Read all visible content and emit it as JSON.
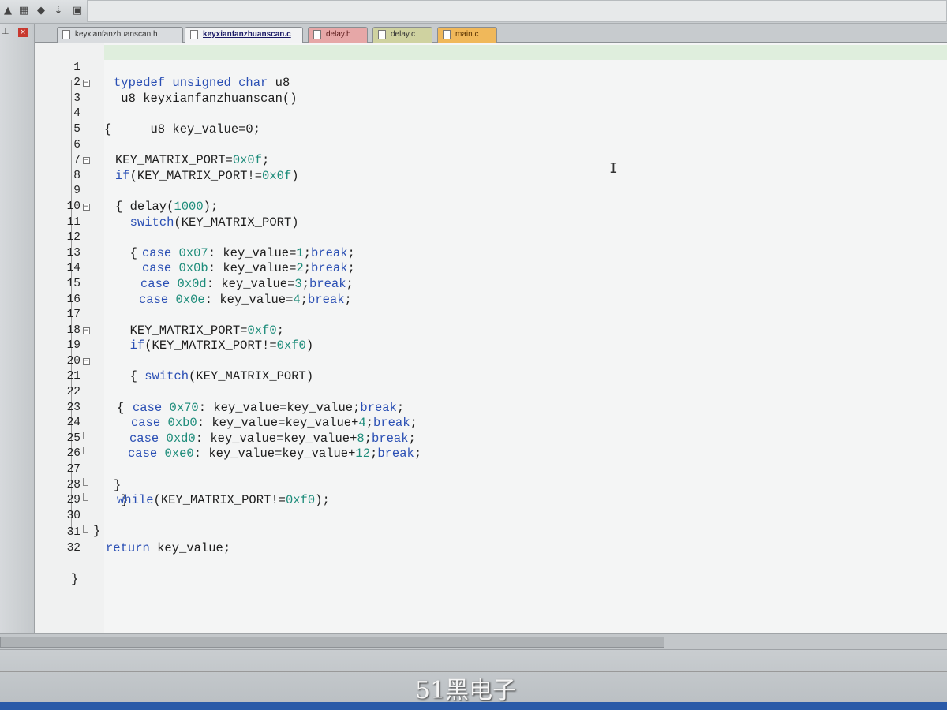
{
  "toolbar": {
    "icons": [
      "build-icon",
      "target-options-icon",
      "debug-icon",
      "download-icon",
      "batch-icon"
    ]
  },
  "left_pane": {
    "pin_icon": "pin-icon",
    "close_icon": "close-icon",
    "pin_glyph": "⊥",
    "close_glyph": "×"
  },
  "tabs": [
    {
      "label": "keyxianfanzhuanscan.h"
    },
    {
      "label": "keyxianfanzhuanscan.c"
    },
    {
      "label": "delay.h"
    },
    {
      "label": "delay.c"
    },
    {
      "label": "main.c"
    }
  ],
  "editor": {
    "lines": [
      {
        "n": "1"
      },
      {
        "n": "2"
      },
      {
        "n": "3"
      },
      {
        "n": "4"
      },
      {
        "n": "5"
      },
      {
        "n": "6"
      },
      {
        "n": "7"
      },
      {
        "n": "8"
      },
      {
        "n": "9"
      },
      {
        "n": "10"
      },
      {
        "n": "11"
      },
      {
        "n": "12"
      },
      {
        "n": "13"
      },
      {
        "n": "14"
      },
      {
        "n": "15"
      },
      {
        "n": "16"
      },
      {
        "n": "17"
      },
      {
        "n": "18"
      },
      {
        "n": "19"
      },
      {
        "n": "20"
      },
      {
        "n": "21"
      },
      {
        "n": "22"
      },
      {
        "n": "23"
      },
      {
        "n": "24"
      },
      {
        "n": "25"
      },
      {
        "n": "26"
      },
      {
        "n": "27"
      },
      {
        "n": "28"
      },
      {
        "n": "29"
      },
      {
        "n": "30"
      },
      {
        "n": "31"
      },
      {
        "n": "32"
      }
    ],
    "code": {
      "l1": [
        "typedef unsigned char",
        " u8"
      ],
      "l2": " u8 keyxianfanzhuanscan()",
      "l3": "{",
      "l4": "     u8 key_value=0;",
      "l6a": "KEY_MATRIX_PORT=",
      "l6b": "0x0f",
      "l6c": ";",
      "l7a": "if",
      "l7b": "(KEY_MATRIX_PORT!=",
      "l7c": "0x0f",
      "l7d": ")",
      "l8": "{",
      "l9a": "  delay(",
      "l9b": "1000",
      "l9c": ");",
      "l10a": "  switch",
      "l10b": "(KEY_MATRIX_PORT)",
      "l11": "  {",
      "l12": [
        "case",
        "0x07",
        ": key_value=",
        "1",
        ";",
        "break",
        ";"
      ],
      "l13": [
        "case",
        "0x0b",
        ": key_value=",
        "2",
        ";",
        "break",
        ";"
      ],
      "l14": [
        "case",
        "0x0d",
        ": key_value=",
        "3",
        ";",
        "break",
        ";"
      ],
      "l15": [
        "case",
        "0x0e",
        ": key_value=",
        "4",
        ";",
        "break",
        ";"
      ],
      "l17a": "  KEY_MATRIX_PORT=",
      "l17b": "0xf0",
      "l17c": ";",
      "l18a": "  if",
      "l18b": "(KEY_MATRIX_PORT!=",
      "l18c": "0xf0",
      "l18d": ")",
      "l19": "  {",
      "l20a": "    switch",
      "l20b": "(KEY_MATRIX_PORT)",
      "l21": "{",
      "l22": [
        "case",
        "0x70",
        ": key_value=key_value;",
        "",
        "",
        "break",
        ";"
      ],
      "l23": [
        "case",
        "0xb0",
        ": key_value=key_value+",
        "4",
        ";",
        "break",
        ";"
      ],
      "l24": [
        "case",
        "0xd0",
        ": key_value=key_value+",
        "8",
        ";",
        "break",
        ";"
      ],
      "l25": [
        "case",
        "0xe0",
        ": key_value=key_value+",
        "12",
        ";",
        "break",
        ";"
      ],
      "l26": "}",
      "l27": " }",
      "l28a": "while",
      "l28b": "(KEY_MATRIX_PORT!=",
      "l28c": "0xf0",
      "l28d": ");",
      "l29": "}",
      "l31a": "return",
      "l31b": " key_value;",
      "l32": "}"
    }
  },
  "cursor_glyph": "I",
  "watermark": "51黑电子",
  "colors": {
    "keyword": "#2a4fb4",
    "number": "#1d8c7a",
    "text": "#1d1d1d"
  }
}
